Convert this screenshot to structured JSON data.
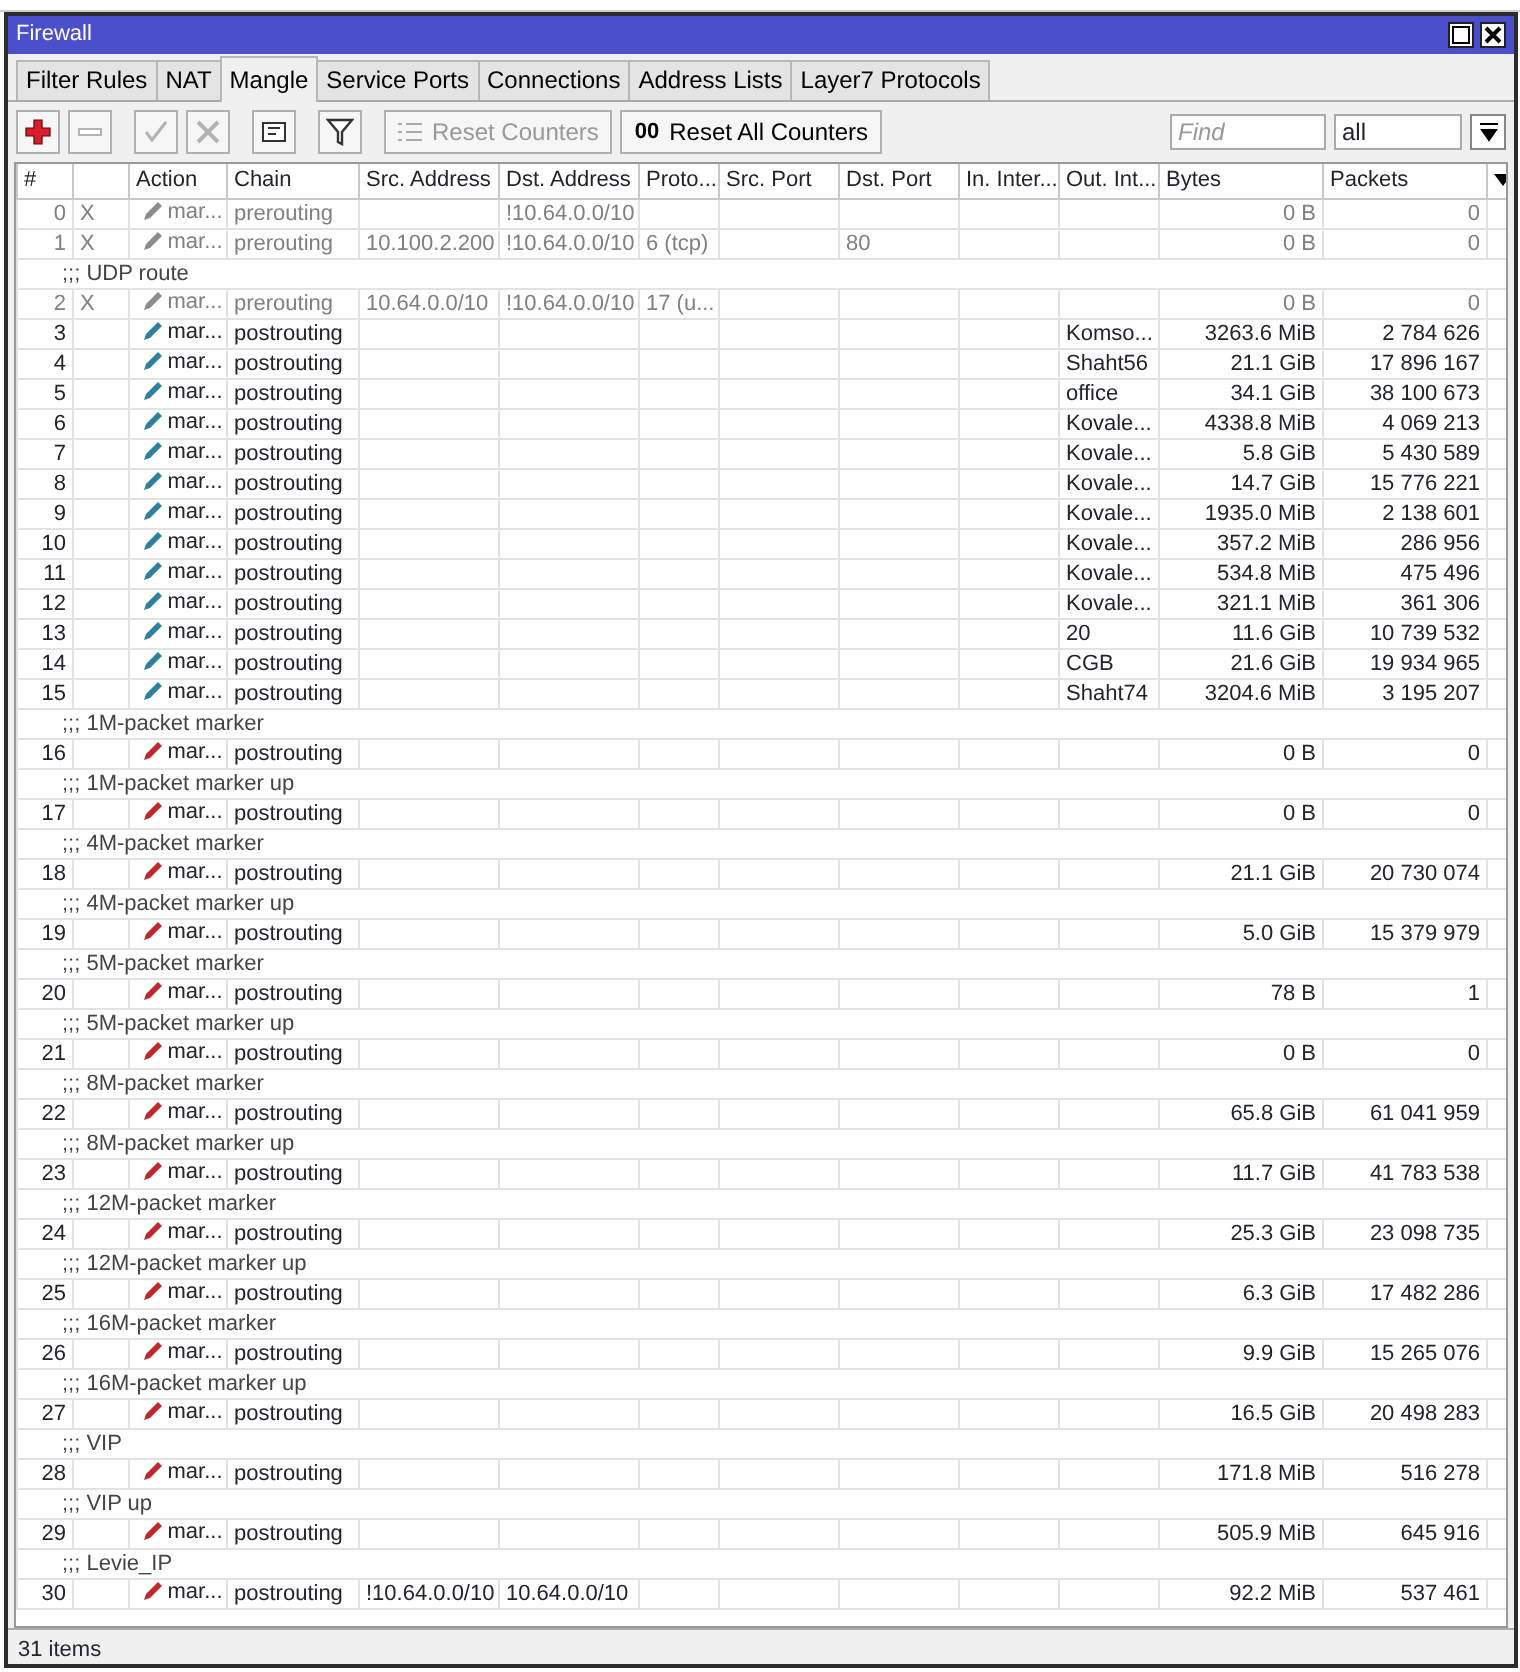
{
  "window": {
    "title": "Firewall"
  },
  "tabs": [
    {
      "label": "Filter Rules",
      "selected": false
    },
    {
      "label": "NAT",
      "selected": false
    },
    {
      "label": "Mangle",
      "selected": true
    },
    {
      "label": "Service Ports",
      "selected": false
    },
    {
      "label": "Connections",
      "selected": false
    },
    {
      "label": "Address Lists",
      "selected": false
    },
    {
      "label": "Layer7 Protocols",
      "selected": false
    }
  ],
  "toolbar": [
    {
      "kind": "add",
      "disabled": false
    },
    {
      "kind": "remove",
      "disabled": true
    },
    {
      "kind": "enable",
      "disabled": true
    },
    {
      "kind": "disable",
      "disabled": true
    },
    {
      "kind": "comment",
      "disabled": false
    },
    {
      "kind": "filter",
      "disabled": false
    }
  ],
  "reset_buttons": [
    {
      "label": "Reset Counters",
      "disabled": true
    },
    {
      "icon_text": "00",
      "label": "Reset All Counters",
      "disabled": false
    }
  ],
  "find": {
    "placeholder": "Find"
  },
  "filter_select": {
    "value": "all"
  },
  "table": {
    "columns": [
      "#",
      "",
      "Action",
      "Chain",
      "Src. Address",
      "Dst. Address",
      "Proto...",
      "Src. Port",
      "Dst. Port",
      "In. Inter...",
      "Out. Int...",
      "Bytes",
      "Packets"
    ],
    "rows": [
      {
        "kind": "rule",
        "num": "0",
        "flag": "X",
        "action": "mar...",
        "chain": "prerouting",
        "dst": "!10.64.0.0/10",
        "bytes": "0 B",
        "packets": "0",
        "disabled": true,
        "color": "#8c8c8c"
      },
      {
        "kind": "rule",
        "num": "1",
        "flag": "X",
        "action": "mar...",
        "chain": "prerouting",
        "src": "10.100.2.200",
        "dst": "!10.64.0.0/10",
        "proto": "6 (tcp)",
        "dst_port": "80",
        "bytes": "0 B",
        "packets": "0",
        "disabled": true,
        "color": "#8c8c8c"
      },
      {
        "kind": "comment",
        "text": ";;; UDP route"
      },
      {
        "kind": "rule",
        "num": "2",
        "flag": "X",
        "action": "mar...",
        "chain": "prerouting",
        "src": "10.64.0.0/10",
        "dst": "!10.64.0.0/10",
        "proto": "17 (u...",
        "bytes": "0 B",
        "packets": "0",
        "disabled": true,
        "color": "#8c8c8c"
      },
      {
        "kind": "rule",
        "num": "3",
        "action": "mar...",
        "chain": "postrouting",
        "out": "Komso...",
        "bytes": "3263.6 MiB",
        "packets": "2 784 626",
        "disabled": false,
        "color": "#2f7f9f"
      },
      {
        "kind": "rule",
        "num": "4",
        "action": "mar...",
        "chain": "postrouting",
        "out": "Shaht56",
        "bytes": "21.1 GiB",
        "packets": "17 896 167",
        "disabled": false,
        "color": "#2f7f9f"
      },
      {
        "kind": "rule",
        "num": "5",
        "action": "mar...",
        "chain": "postrouting",
        "out": "office",
        "bytes": "34.1 GiB",
        "packets": "38 100 673",
        "disabled": false,
        "color": "#2f7f9f"
      },
      {
        "kind": "rule",
        "num": "6",
        "action": "mar...",
        "chain": "postrouting",
        "out": "Kovale...",
        "bytes": "4338.8 MiB",
        "packets": "4 069 213",
        "disabled": false,
        "color": "#2f7f9f"
      },
      {
        "kind": "rule",
        "num": "7",
        "action": "mar...",
        "chain": "postrouting",
        "out": "Kovale...",
        "bytes": "5.8 GiB",
        "packets": "5 430 589",
        "disabled": false,
        "color": "#2f7f9f"
      },
      {
        "kind": "rule",
        "num": "8",
        "action": "mar...",
        "chain": "postrouting",
        "out": "Kovale...",
        "bytes": "14.7 GiB",
        "packets": "15 776 221",
        "disabled": false,
        "color": "#2f7f9f"
      },
      {
        "kind": "rule",
        "num": "9",
        "action": "mar...",
        "chain": "postrouting",
        "out": "Kovale...",
        "bytes": "1935.0 MiB",
        "packets": "2 138 601",
        "disabled": false,
        "color": "#2f7f9f"
      },
      {
        "kind": "rule",
        "num": "10",
        "action": "mar...",
        "chain": "postrouting",
        "out": "Kovale...",
        "bytes": "357.2 MiB",
        "packets": "286 956",
        "disabled": false,
        "color": "#2f7f9f"
      },
      {
        "kind": "rule",
        "num": "11",
        "action": "mar...",
        "chain": "postrouting",
        "out": "Kovale...",
        "bytes": "534.8 MiB",
        "packets": "475 496",
        "disabled": false,
        "color": "#2f7f9f"
      },
      {
        "kind": "rule",
        "num": "12",
        "action": "mar...",
        "chain": "postrouting",
        "out": "Kovale...",
        "bytes": "321.1 MiB",
        "packets": "361 306",
        "disabled": false,
        "color": "#2f7f9f"
      },
      {
        "kind": "rule",
        "num": "13",
        "action": "mar...",
        "chain": "postrouting",
        "out": "20",
        "bytes": "11.6 GiB",
        "packets": "10 739 532",
        "disabled": false,
        "color": "#2f7f9f"
      },
      {
        "kind": "rule",
        "num": "14",
        "action": "mar...",
        "chain": "postrouting",
        "out": "CGB",
        "bytes": "21.6 GiB",
        "packets": "19 934 965",
        "disabled": false,
        "color": "#2f7f9f"
      },
      {
        "kind": "rule",
        "num": "15",
        "action": "mar...",
        "chain": "postrouting",
        "out": "Shaht74",
        "bytes": "3204.6 MiB",
        "packets": "3 195 207",
        "disabled": false,
        "color": "#2f7f9f"
      },
      {
        "kind": "comment",
        "text": ";;; 1M-packet marker"
      },
      {
        "kind": "rule",
        "num": "16",
        "action": "mar...",
        "chain": "postrouting",
        "bytes": "0 B",
        "packets": "0",
        "disabled": false,
        "color": "#c0282d"
      },
      {
        "kind": "comment",
        "text": ";;; 1M-packet marker up"
      },
      {
        "kind": "rule",
        "num": "17",
        "action": "mar...",
        "chain": "postrouting",
        "bytes": "0 B",
        "packets": "0",
        "disabled": false,
        "color": "#c0282d"
      },
      {
        "kind": "comment",
        "text": ";;; 4M-packet marker"
      },
      {
        "kind": "rule",
        "num": "18",
        "action": "mar...",
        "chain": "postrouting",
        "bytes": "21.1 GiB",
        "packets": "20 730 074",
        "disabled": false,
        "color": "#c0282d"
      },
      {
        "kind": "comment",
        "text": ";;; 4M-packet marker up"
      },
      {
        "kind": "rule",
        "num": "19",
        "action": "mar...",
        "chain": "postrouting",
        "bytes": "5.0 GiB",
        "packets": "15 379 979",
        "disabled": false,
        "color": "#c0282d"
      },
      {
        "kind": "comment",
        "text": ";;; 5M-packet marker"
      },
      {
        "kind": "rule",
        "num": "20",
        "action": "mar...",
        "chain": "postrouting",
        "bytes": "78 B",
        "packets": "1",
        "disabled": false,
        "color": "#c0282d"
      },
      {
        "kind": "comment",
        "text": ";;; 5M-packet marker up"
      },
      {
        "kind": "rule",
        "num": "21",
        "action": "mar...",
        "chain": "postrouting",
        "bytes": "0 B",
        "packets": "0",
        "disabled": false,
        "color": "#c0282d"
      },
      {
        "kind": "comment",
        "text": ";;; 8M-packet marker"
      },
      {
        "kind": "rule",
        "num": "22",
        "action": "mar...",
        "chain": "postrouting",
        "bytes": "65.8 GiB",
        "packets": "61 041 959",
        "disabled": false,
        "color": "#c0282d"
      },
      {
        "kind": "comment",
        "text": ";;; 8M-packet marker up"
      },
      {
        "kind": "rule",
        "num": "23",
        "action": "mar...",
        "chain": "postrouting",
        "bytes": "11.7 GiB",
        "packets": "41 783 538",
        "disabled": false,
        "color": "#c0282d"
      },
      {
        "kind": "comment",
        "text": ";;; 12M-packet marker"
      },
      {
        "kind": "rule",
        "num": "24",
        "action": "mar...",
        "chain": "postrouting",
        "bytes": "25.3 GiB",
        "packets": "23 098 735",
        "disabled": false,
        "color": "#c0282d"
      },
      {
        "kind": "comment",
        "text": ";;; 12M-packet marker up"
      },
      {
        "kind": "rule",
        "num": "25",
        "action": "mar...",
        "chain": "postrouting",
        "bytes": "6.3 GiB",
        "packets": "17 482 286",
        "disabled": false,
        "color": "#c0282d"
      },
      {
        "kind": "comment",
        "text": ";;; 16M-packet marker"
      },
      {
        "kind": "rule",
        "num": "26",
        "action": "mar...",
        "chain": "postrouting",
        "bytes": "9.9 GiB",
        "packets": "15 265 076",
        "disabled": false,
        "color": "#c0282d"
      },
      {
        "kind": "comment",
        "text": ";;; 16M-packet marker up"
      },
      {
        "kind": "rule",
        "num": "27",
        "action": "mar...",
        "chain": "postrouting",
        "bytes": "16.5 GiB",
        "packets": "20 498 283",
        "disabled": false,
        "color": "#c0282d"
      },
      {
        "kind": "comment",
        "text": ";;; VIP"
      },
      {
        "kind": "rule",
        "num": "28",
        "action": "mar...",
        "chain": "postrouting",
        "bytes": "171.8 MiB",
        "packets": "516 278",
        "disabled": false,
        "color": "#c0282d"
      },
      {
        "kind": "comment",
        "text": ";;; VIP up"
      },
      {
        "kind": "rule",
        "num": "29",
        "action": "mar...",
        "chain": "postrouting",
        "bytes": "505.9 MiB",
        "packets": "645 916",
        "disabled": false,
        "color": "#c0282d"
      },
      {
        "kind": "comment",
        "text": ";;; Levie_IP"
      },
      {
        "kind": "rule",
        "num": "30",
        "action": "mar...",
        "chain": "postrouting",
        "src": "!10.64.0.0/10",
        "dst": "10.64.0.0/10",
        "bytes": "92.2 MiB",
        "packets": "537 461",
        "disabled": false,
        "color": "#c0282d"
      }
    ]
  },
  "status_bar": {
    "text": "31 items"
  }
}
